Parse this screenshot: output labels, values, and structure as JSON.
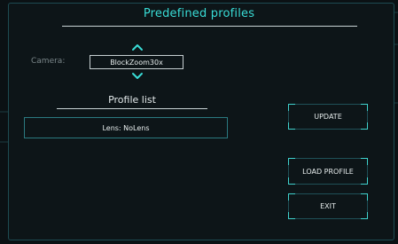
{
  "dialog": {
    "title": "Predefined profiles"
  },
  "camera": {
    "label": "Camera:",
    "value": "BlockZoom30x",
    "up_icon": "chevron-up-icon",
    "down_icon": "chevron-down-icon"
  },
  "profiles": {
    "heading": "Profile list",
    "items": [
      {
        "label": "Lens: NoLens"
      }
    ]
  },
  "buttons": {
    "update": "UPDATE",
    "load_profile": "LOAD PROFILE",
    "exit": "EXIT"
  },
  "colors": {
    "accent": "#39dcd6",
    "border": "#2b7a80",
    "background": "#0d1518"
  }
}
